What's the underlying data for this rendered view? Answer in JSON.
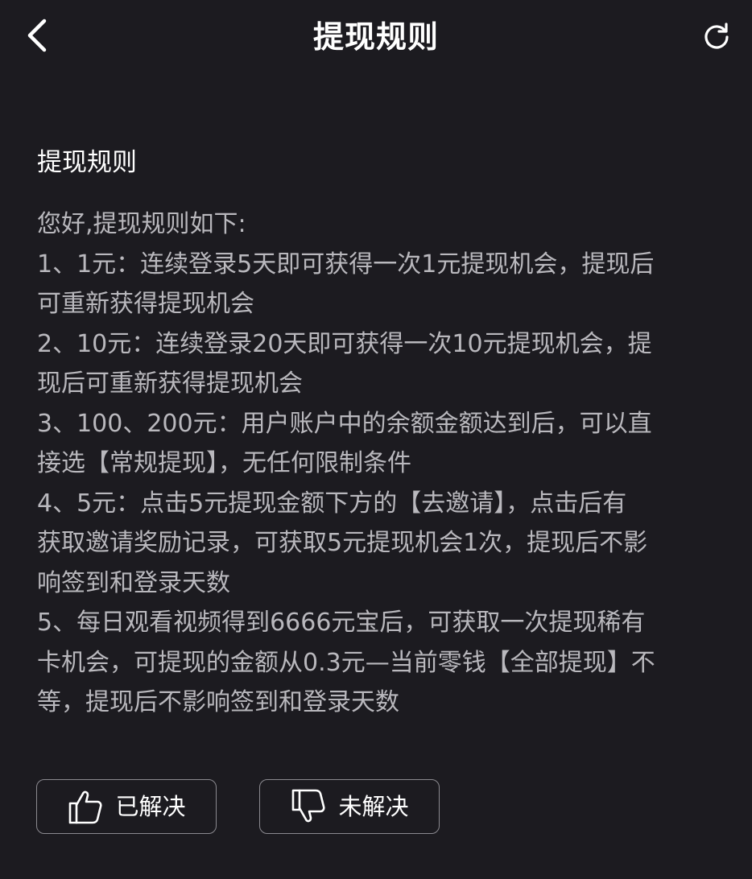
{
  "header": {
    "title": "提现规则",
    "back_icon": "chevron-left-icon",
    "refresh_icon": "refresh-icon"
  },
  "content": {
    "section_title": "提现规则",
    "lines": [
      "您好,提现规则如下:",
      "1、1元：连续登录5天即可获得一次1元提现机会，提现后",
      "可重新获得提现机会",
      "2、10元：连续登录20天即可获得一次10元提现机会，提",
      "现后可重新获得提现机会",
      "3、100、200元：用户账户中的余额金额达到后，可以直",
      "接选【常规提现】，无任何限制条件",
      "4、5元：点击5元提现金额下方的【去邀请】，点击后有",
      "获取邀请奖励记录，可获取5元提现机会1次，提现后不影",
      "响签到和登录天数",
      "5、每日观看视频得到6666元宝后，可获取一次提现稀有",
      "卡机会，可提现的金额从0.3元—当前零钱【全部提现】不",
      "等，提现后不影响签到和登录天数"
    ]
  },
  "feedback": {
    "solved_label": "已解决",
    "unsolved_label": "未解决",
    "solved_icon": "thumbs-up-icon",
    "unsolved_icon": "thumbs-down-icon"
  },
  "colors": {
    "background": "#1c1b20",
    "title_text": "#ffffff",
    "body_text": "#b9b8bd",
    "button_border": "#8b8a90"
  }
}
